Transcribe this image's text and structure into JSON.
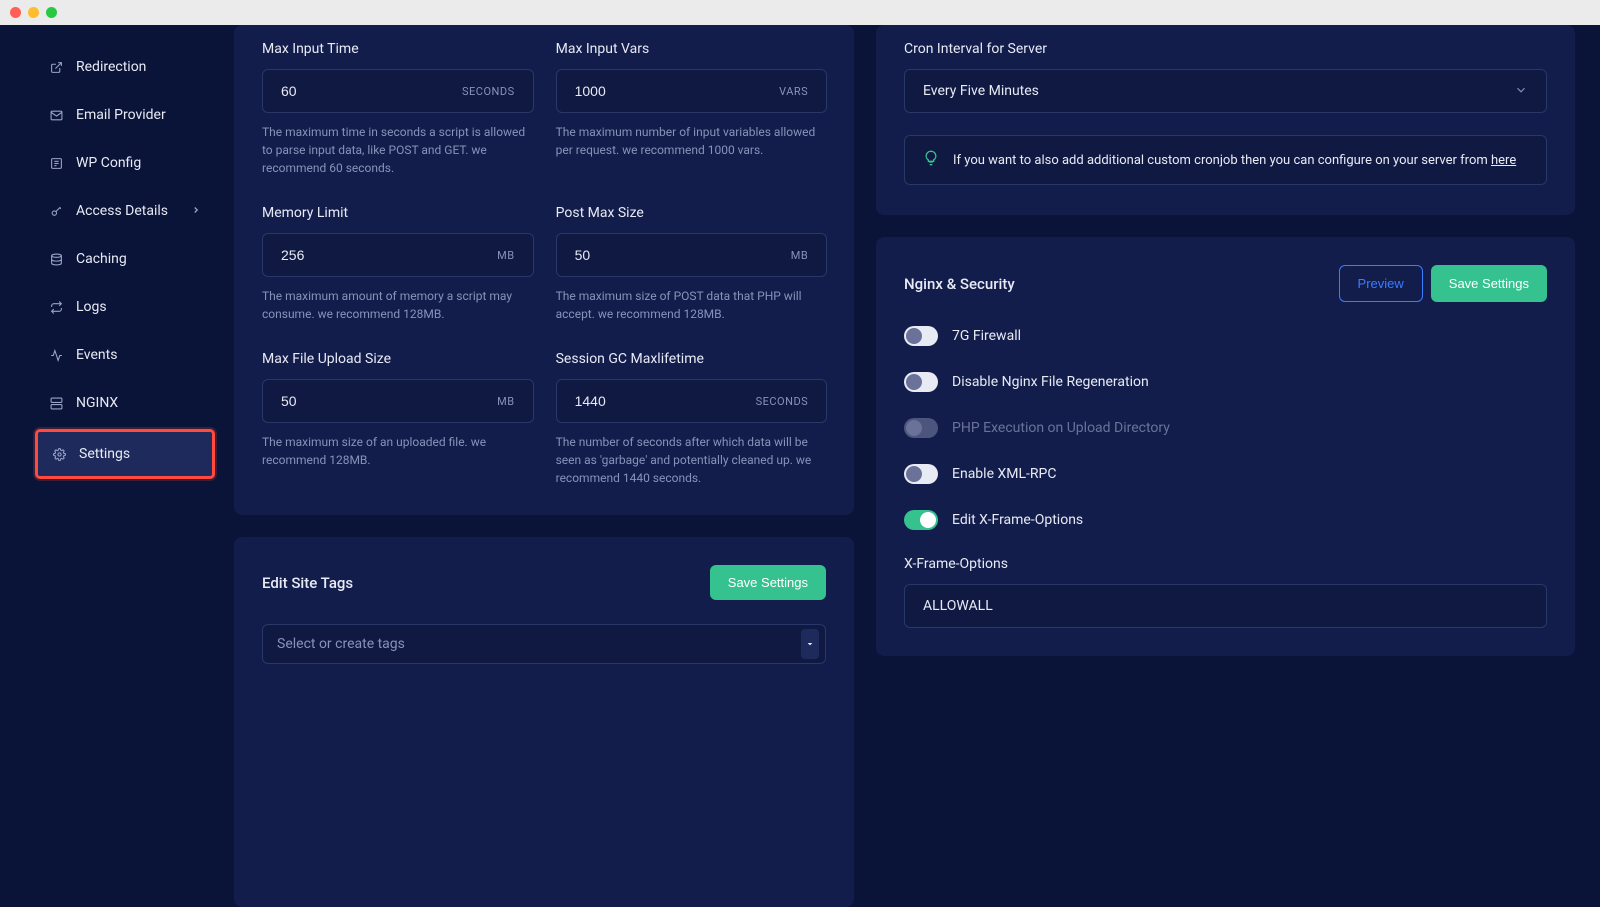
{
  "sidebar": {
    "items": [
      {
        "label": "Redirection"
      },
      {
        "label": "Email Provider"
      },
      {
        "label": "WP Config"
      },
      {
        "label": "Access Details"
      },
      {
        "label": "Caching"
      },
      {
        "label": "Logs"
      },
      {
        "label": "Events"
      },
      {
        "label": "NGINX"
      },
      {
        "label": "Settings"
      }
    ]
  },
  "php": {
    "maxInputTime": {
      "label": "Max Input Time",
      "value": "60",
      "unit": "SECONDS",
      "help": "The maximum time in seconds a script is allowed to parse input data, like POST and GET. we recommend 60 seconds."
    },
    "maxInputVars": {
      "label": "Max Input Vars",
      "value": "1000",
      "unit": "VARS",
      "help": "The maximum number of input variables allowed per request. we recommend 1000 vars."
    },
    "memoryLimit": {
      "label": "Memory Limit",
      "value": "256",
      "unit": "MB",
      "help": "The maximum amount of memory a script may consume. we recommend 128MB."
    },
    "postMaxSize": {
      "label": "Post Max Size",
      "value": "50",
      "unit": "MB",
      "help": "The maximum size of POST data that PHP will accept. we recommend 128MB."
    },
    "maxFileUpload": {
      "label": "Max File Upload Size",
      "value": "50",
      "unit": "MB",
      "help": "The maximum size of an uploaded file. we recommend 128MB."
    },
    "sessionGc": {
      "label": "Session GC Maxlifetime",
      "value": "1440",
      "unit": "SECONDS",
      "help": "The number of seconds after which data will be seen as 'garbage' and potentially cleaned up. we recommend 1440 seconds."
    }
  },
  "tags": {
    "title": "Edit Site Tags",
    "save": "Save Settings",
    "placeholder": "Select or create tags"
  },
  "cron": {
    "label": "Cron Interval for Server",
    "value": "Every Five Minutes",
    "noticePrefix": "If you want to also add additional custom cronjob then you can configure on your server from ",
    "noticeLink": "here"
  },
  "security": {
    "title": "Nginx & Security",
    "preview": "Preview",
    "save": "Save Settings",
    "toggles": [
      {
        "label": "7G Firewall",
        "on": false,
        "disabled": false
      },
      {
        "label": "Disable Nginx File Regeneration",
        "on": false,
        "disabled": false
      },
      {
        "label": "PHP Execution on Upload Directory",
        "on": false,
        "disabled": true
      },
      {
        "label": "Enable XML-RPC",
        "on": false,
        "disabled": false
      },
      {
        "label": "Edit X-Frame-Options",
        "on": true,
        "disabled": false
      }
    ],
    "xframe": {
      "label": "X-Frame-Options",
      "value": "ALLOWALL"
    }
  }
}
